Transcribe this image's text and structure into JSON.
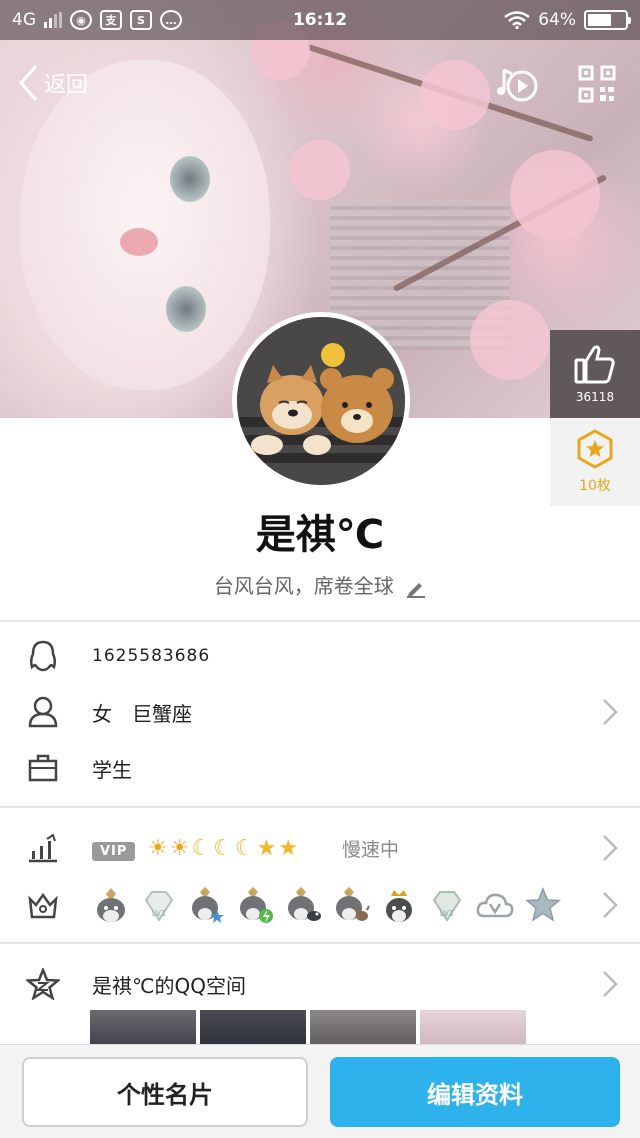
{
  "status_bar": {
    "network": "4G",
    "time": "16:12",
    "battery": "64%",
    "battery_level": 0.64,
    "app_icons": [
      "globe-icon",
      "pay-icon",
      "screenshot-icon",
      "message-icon"
    ]
  },
  "header": {
    "back_label": "返回",
    "music_icon": "music-icon",
    "qr_icon": "qr-code-icon"
  },
  "side": {
    "like_count": "36118",
    "badge_count": "10枚"
  },
  "profile": {
    "nickname": "是祺℃",
    "signature": "台风台风，席卷全球"
  },
  "info_rows": [
    {
      "icon": "penguin-icon",
      "text": "1625583686"
    },
    {
      "icon": "person-icon",
      "text": "女　巨蟹座"
    },
    {
      "icon": "briefcase-icon",
      "text": "学生"
    }
  ],
  "level_row": {
    "icon": "chart-icon",
    "vip_tag": "VIP",
    "level_icons": [
      "☀",
      "☀",
      "☾",
      "☾",
      "☾",
      "★",
      "★"
    ],
    "speed_text": "慢速中"
  },
  "badges_row": {
    "icon": "crown-icon",
    "items": [
      "penguin-badge",
      "diamond-lv1-badge",
      "penguin-star-badge",
      "penguin-bolt-badge",
      "penguin-bird-badge",
      "penguin-moose-badge",
      "penguin-crown-badge",
      "diamond-lv1-badge-2",
      "cloud-v-badge",
      "star-badge"
    ],
    "lv1_label": "LV1"
  },
  "qzone_row": {
    "icon": "qzone-star-icon",
    "text": "是祺℃的QQ空间"
  },
  "colors": {
    "accent": "#2db2ec",
    "badge_gold": "#e8a81e"
  },
  "bottom": {
    "card_label": "个性名片",
    "edit_label": "编辑资料"
  }
}
